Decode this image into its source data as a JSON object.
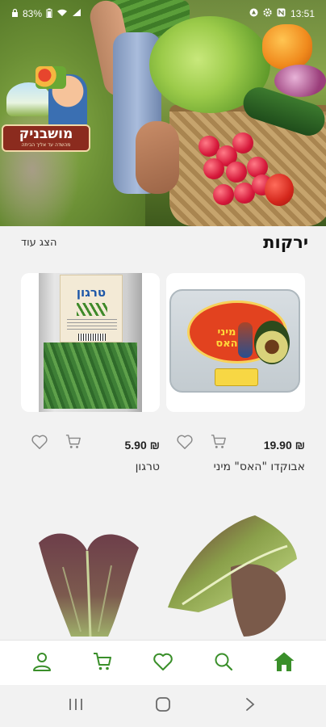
{
  "status_bar": {
    "battery": "83%",
    "time": "13:51"
  },
  "logo": {
    "name": "מושבניק",
    "tagline": "מהשדה עד אליך הביתה"
  },
  "section": {
    "title": "ירקות",
    "show_more": "הצג עוד"
  },
  "products": [
    {
      "name": "אבוקדו \"האס\" מיני",
      "price": "19.90 ₪",
      "pack_label": "מיני האס",
      "icons": {
        "cart": "cart-icon",
        "favorite": "heart-icon"
      }
    },
    {
      "name": "טרגון",
      "price": "5.90 ₪",
      "pack_label": "טרגון",
      "icons": {
        "cart": "cart-icon",
        "favorite": "heart-icon"
      }
    }
  ],
  "bottom_nav": [
    {
      "name": "home",
      "icon": "home-icon"
    },
    {
      "name": "search",
      "icon": "search-icon"
    },
    {
      "name": "favorites",
      "icon": "heart-icon"
    },
    {
      "name": "cart",
      "icon": "cart-icon"
    },
    {
      "name": "profile",
      "icon": "user-icon"
    }
  ],
  "colors": {
    "accent": "#3a8f2a",
    "icon_gray": "#8a8a8a",
    "background": "#f2f2f2"
  }
}
